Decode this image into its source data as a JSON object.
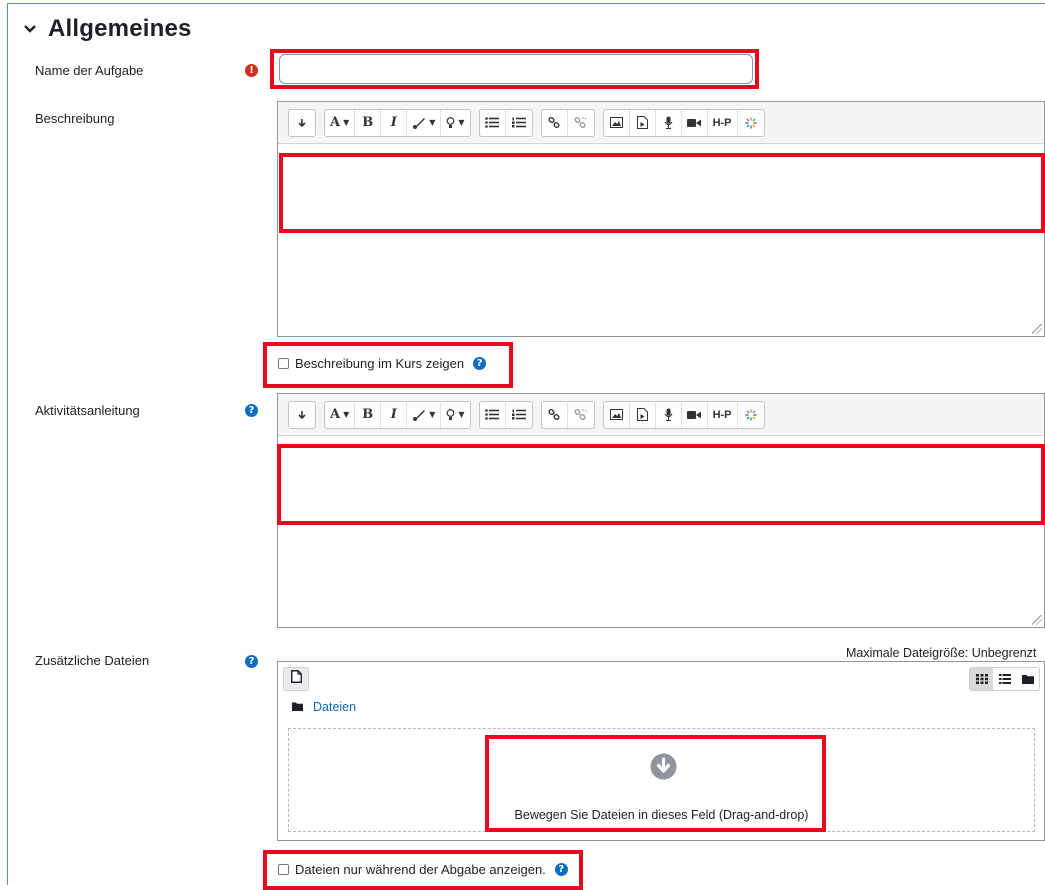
{
  "section": {
    "title": "Allgemeines"
  },
  "fields": {
    "name": {
      "label": "Name der Aufgabe",
      "value": "",
      "placeholder": ""
    },
    "description": {
      "label": "Beschreibung",
      "show_in_course_label": "Beschreibung im Kurs zeigen"
    },
    "activity": {
      "label": "Aktivitätsanleitung"
    },
    "files": {
      "label": "Zusätzliche Dateien",
      "max_size": "Maximale Dateigröße: Unbegrenzt",
      "folder_label": "Dateien",
      "drop_text": "Bewegen Sie Dateien in dieses Feld (Drag-and-drop)",
      "only_during_submission_label": "Dateien nur während der Abgabe anzeigen."
    }
  },
  "toolbar": {
    "bold_label": "B",
    "italic_label": "I",
    "font_label": "A",
    "h5p_label": "H-P"
  },
  "colors": {
    "highlight": "#e8091e",
    "required": "#ca3120",
    "help": "#0f6cbf",
    "link": "#0f6cbf"
  },
  "icons": {
    "section_toggle": "chevron-down-icon",
    "required": "exclamation-circle-icon",
    "help": "question-circle-icon",
    "drop": "arrow-down-circle-icon"
  }
}
